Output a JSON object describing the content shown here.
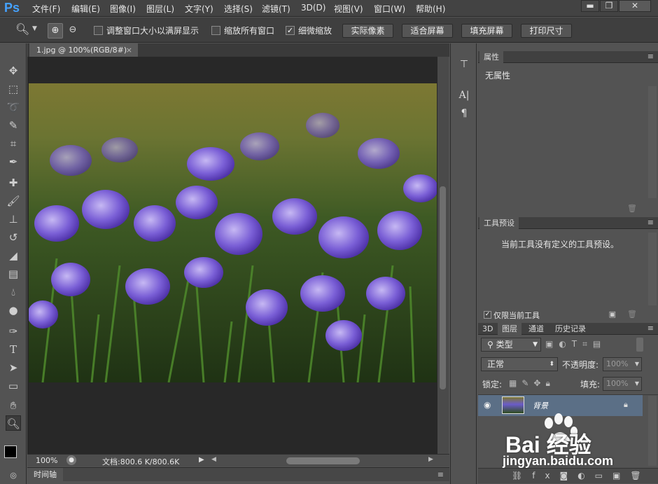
{
  "app": {
    "logo": "Ps"
  },
  "menu": [
    "文件(F)",
    "编辑(E)",
    "图像(I)",
    "图层(L)",
    "文字(Y)",
    "选择(S)",
    "滤镜(T)",
    "3D(D)",
    "视图(V)",
    "窗口(W)",
    "帮助(H)"
  ],
  "window_buttons": {
    "minimize": "▬",
    "maximize": "❐",
    "close": "✕"
  },
  "options": {
    "resize_windows": "调整窗口大小以满屏显示",
    "zoom_all": "缩放所有窗口",
    "scrubby_zoom": "细微缩放",
    "scrubby_checked": true,
    "actual_pixels": "实际像素",
    "fit_screen": "适合屏幕",
    "fill_screen": "填充屏幕",
    "print_size": "打印尺寸"
  },
  "document": {
    "tab_title": "1.jpg @ 100%(RGB/8#)",
    "tab_close": "×",
    "zoom": "100%",
    "doc_info": "文档:800.6 K/800.6K"
  },
  "timeline": {
    "label": "时间轴"
  },
  "properties_panel": {
    "tab": "属性",
    "content": "无属性"
  },
  "tool_presets_panel": {
    "tab": "工具预设",
    "content": "当前工具没有定义的工具预设。",
    "current_only_label": "仅限当前工具"
  },
  "layers_panel": {
    "tabs": [
      "3D",
      "图层",
      "通道",
      "历史记录"
    ],
    "active_tab": "图层",
    "filter_type": "类型",
    "blend_mode": "正常",
    "opacity_label": "不透明度:",
    "opacity_value": "100%",
    "lock_label": "锁定:",
    "fill_label": "填充:",
    "fill_value": "100%",
    "layers": [
      {
        "name": "背景",
        "locked": true,
        "visible": true
      }
    ]
  },
  "watermark": {
    "brand": "Bai 经验",
    "url": "jingyan.baidu.com"
  },
  "colors": {
    "accent": "#45a2ff",
    "ui_bg": "#535353",
    "selected_layer": "#5b6f86"
  }
}
